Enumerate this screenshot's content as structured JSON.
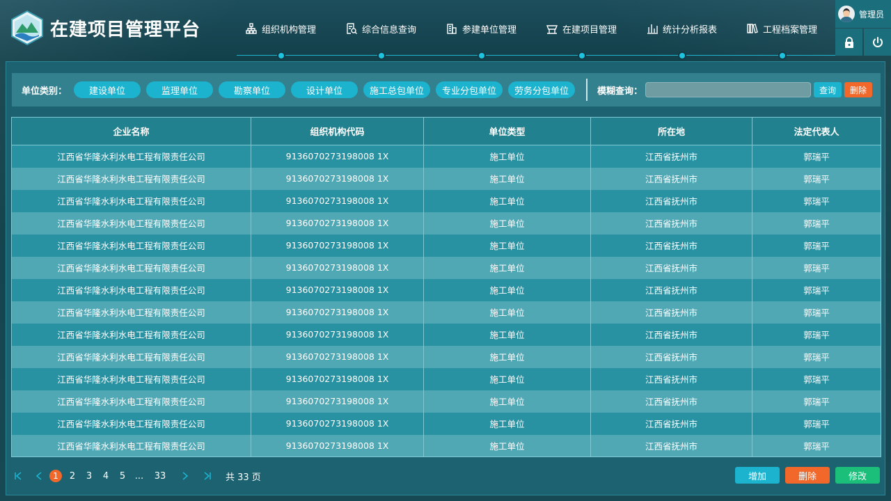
{
  "app": {
    "title": "在建项目管理平台"
  },
  "nav": [
    {
      "label": "组织机构管理",
      "icon": "org-chart-icon"
    },
    {
      "label": "综合信息查询",
      "icon": "doc-search-icon"
    },
    {
      "label": "参建单位管理",
      "icon": "building-icon"
    },
    {
      "label": "在建项目管理",
      "icon": "construction-icon"
    },
    {
      "label": "统计分析报表",
      "icon": "bar-chart-icon"
    },
    {
      "label": "工程档案管理",
      "icon": "archive-icon"
    }
  ],
  "user": {
    "name": "管理员",
    "lock_icon": "lock-icon",
    "power_icon": "power-icon"
  },
  "filter": {
    "label": "单位类别：",
    "chips": [
      "建设单位",
      "监理单位",
      "勘察单位",
      "设计单位",
      "施工总包单位",
      "专业分包单位",
      "劳务分包单位"
    ],
    "search_label": "模糊查询：",
    "search_value": "",
    "query_btn": "查询",
    "delete_btn": "删除"
  },
  "table": {
    "headers": [
      "企业名称",
      "组织机构代码",
      "单位类型",
      "所在地",
      "法定代表人"
    ],
    "rows": [
      [
        "江西省华隆水利水电工程有限责任公司",
        "9136070273198008 1X",
        "施工单位",
        "江西省抚州市",
        "郭瑞平"
      ],
      [
        "江西省华隆水利水电工程有限责任公司",
        "9136070273198008 1X",
        "施工单位",
        "江西省抚州市",
        "郭瑞平"
      ],
      [
        "江西省华隆水利水电工程有限责任公司",
        "9136070273198008 1X",
        "施工单位",
        "江西省抚州市",
        "郭瑞平"
      ],
      [
        "江西省华隆水利水电工程有限责任公司",
        "9136070273198008 1X",
        "施工单位",
        "江西省抚州市",
        "郭瑞平"
      ],
      [
        "江西省华隆水利水电工程有限责任公司",
        "9136070273198008 1X",
        "施工单位",
        "江西省抚州市",
        "郭瑞平"
      ],
      [
        "江西省华隆水利水电工程有限责任公司",
        "9136070273198008 1X",
        "施工单位",
        "江西省抚州市",
        "郭瑞平"
      ],
      [
        "江西省华隆水利水电工程有限责任公司",
        "9136070273198008 1X",
        "施工单位",
        "江西省抚州市",
        "郭瑞平"
      ],
      [
        "江西省华隆水利水电工程有限责任公司",
        "9136070273198008 1X",
        "施工单位",
        "江西省抚州市",
        "郭瑞平"
      ],
      [
        "江西省华隆水利水电工程有限责任公司",
        "9136070273198008 1X",
        "施工单位",
        "江西省抚州市",
        "郭瑞平"
      ],
      [
        "江西省华隆水利水电工程有限责任公司",
        "9136070273198008 1X",
        "施工单位",
        "江西省抚州市",
        "郭瑞平"
      ],
      [
        "江西省华隆水利水电工程有限责任公司",
        "9136070273198008 1X",
        "施工单位",
        "江西省抚州市",
        "郭瑞平"
      ],
      [
        "江西省华隆水利水电工程有限责任公司",
        "9136070273198008 1X",
        "施工单位",
        "江西省抚州市",
        "郭瑞平"
      ],
      [
        "江西省华隆水利水电工程有限责任公司",
        "9136070273198008 1X",
        "施工单位",
        "江西省抚州市",
        "郭瑞平"
      ],
      [
        "江西省华隆水利水电工程有限责任公司",
        "9136070273198008 1X",
        "施工单位",
        "江西省抚州市",
        "郭瑞平"
      ]
    ]
  },
  "pager": {
    "current": "1",
    "pages": [
      "2",
      "3",
      "4",
      "5",
      "...",
      "33"
    ],
    "total": "共 33 页"
  },
  "actions": {
    "add": "增加",
    "delete": "删除",
    "edit": "修改"
  },
  "colors": {
    "accent": "#1cb3cf",
    "danger": "#f2682a",
    "success": "#1bbf7a"
  }
}
